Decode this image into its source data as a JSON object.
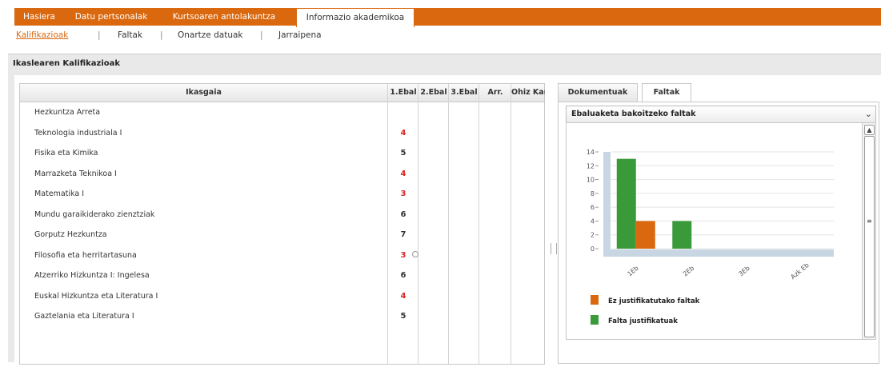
{
  "nav": {
    "tabs": [
      "Hasiera",
      "Datu pertsonalak",
      "Kurtsoaren antolakuntza",
      "Informazio akademikoa"
    ],
    "active_tab": "Informazio akademikoa",
    "subtabs": [
      "Kalifikazioak",
      "Faltak",
      "Onartze datuak",
      "Jarraipena"
    ],
    "separator": "|",
    "active_subtab": "Kalifikazioak"
  },
  "panel": {
    "title": "Ikaslearen Kalifikazioak"
  },
  "grid": {
    "columns": [
      "Ikasgaia",
      "1.Ebal",
      "2.Ebal",
      "3.Ebal",
      "Arr.",
      "Ohiz Kanp."
    ],
    "rows": [
      {
        "subject": "Hezkuntza Arreta",
        "grade": ""
      },
      {
        "subject": "Teknologia industriala I",
        "grade": "4"
      },
      {
        "subject": "Fisika eta Kimika",
        "grade": "5"
      },
      {
        "subject": "Marrazketa Teknikoa I",
        "grade": "4"
      },
      {
        "subject": "Matematika I",
        "grade": "3"
      },
      {
        "subject": "Mundu garaikiderako zienztziak",
        "grade": "6"
      },
      {
        "subject": "Gorputz Hezkuntza",
        "grade": "7"
      },
      {
        "subject": "Filosofia eta herritartasuna",
        "grade": "3"
      },
      {
        "subject": "Atzerriko Hizkuntza I: Ingelesa",
        "grade": "6"
      },
      {
        "subject": "Euskal Hizkuntza eta Literatura I",
        "grade": "4"
      },
      {
        "subject": "Gaztelania eta Literatura I",
        "grade": "5"
      }
    ]
  },
  "right_panel": {
    "tabs": [
      "Dokumentuak",
      "Faltak"
    ],
    "active_tab": "Faltak",
    "select_value": "Ebaluaketa bakoitzeko faltak"
  },
  "colors": {
    "accent": "#d9680f",
    "fail": "#dd2222",
    "unjustified": "#d9680f",
    "justified": "#3a9a3a",
    "axis_band": "#c8d6e4"
  },
  "chart_data": {
    "type": "bar",
    "categories": [
      "1Eb",
      "2Eb",
      "3Eb",
      "Azk Eb"
    ],
    "series": [
      {
        "name": "Ez justifikatutako faltak",
        "values": [
          4,
          0,
          0,
          0
        ]
      },
      {
        "name": "Falta justifikatuak",
        "values": [
          13,
          4,
          0,
          0
        ]
      }
    ],
    "yticks": [
      0,
      2,
      4,
      6,
      8,
      10,
      12,
      14
    ],
    "ylim": [
      0,
      14
    ],
    "grid": true,
    "legend": "bottom"
  }
}
